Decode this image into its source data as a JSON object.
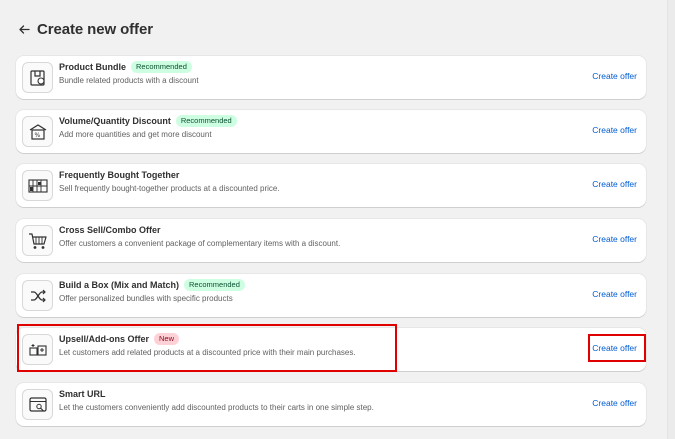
{
  "page": {
    "title": "Create new offer"
  },
  "accent_color": "#005bd3",
  "highlight_color": "#e00000",
  "offers": [
    {
      "title": "Product Bundle",
      "badge": "Recommended",
      "badge_color": "green",
      "description": "Bundle related products with a discount",
      "cta": "Create offer",
      "icon": "product-bundle-icon"
    },
    {
      "title": "Volume/Quantity Discount",
      "badge": "Recommended",
      "badge_color": "green",
      "description": "Add more quantities and get more discount",
      "cta": "Create offer",
      "icon": "volume-discount-icon"
    },
    {
      "title": "Frequently Bought Together",
      "badge": "",
      "badge_color": "",
      "description": "Sell frequently bought-together products at a discounted price.",
      "cta": "Create offer",
      "icon": "bought-together-icon"
    },
    {
      "title": "Cross Sell/Combo Offer",
      "badge": "",
      "badge_color": "",
      "description": "Offer customers a convenient package of complementary items with a discount.",
      "cta": "Create offer",
      "icon": "cart-icon"
    },
    {
      "title": "Build a Box (Mix and Match)",
      "badge": "Recommended",
      "badge_color": "green",
      "description": "Offer personalized bundles with specific products",
      "cta": "Create offer",
      "icon": "shuffle-icon"
    },
    {
      "title": "Upsell/Add-ons Offer",
      "badge": "New",
      "badge_color": "red",
      "description": "Let customers add related products at a discounted price with their main purchases.",
      "cta": "Create offer",
      "icon": "upsell-addons-icon"
    },
    {
      "title": "Smart URL",
      "badge": "",
      "badge_color": "",
      "description": "Let the customers conveniently add discounted products to their carts in one simple step.",
      "cta": "Create offer",
      "icon": "smart-url-icon"
    }
  ]
}
